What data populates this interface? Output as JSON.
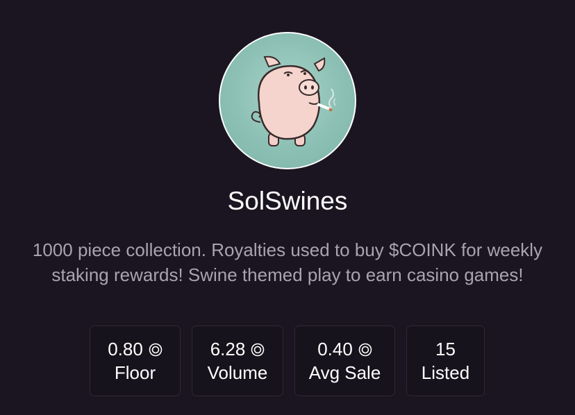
{
  "collection": {
    "name": "SolSwines",
    "description": "1000 piece collection. Royalties used to buy $COINK for weekly staking rewards! Swine themed play to earn casino games!",
    "avatar_icon": "smoking-pig-icon"
  },
  "stats": [
    {
      "value": "0.80",
      "label": "Floor",
      "currency_icon": "sol-icon"
    },
    {
      "value": "6.28",
      "label": "Volume",
      "currency_icon": "sol-icon"
    },
    {
      "value": "0.40",
      "label": "Avg Sale",
      "currency_icon": "sol-icon"
    },
    {
      "value": "15",
      "label": "Listed"
    }
  ],
  "colors": {
    "background": "#1a1520",
    "avatar_bg": "#8cc0b4",
    "muted_text": "#aaa3b2",
    "card_border": "#2e2836"
  }
}
